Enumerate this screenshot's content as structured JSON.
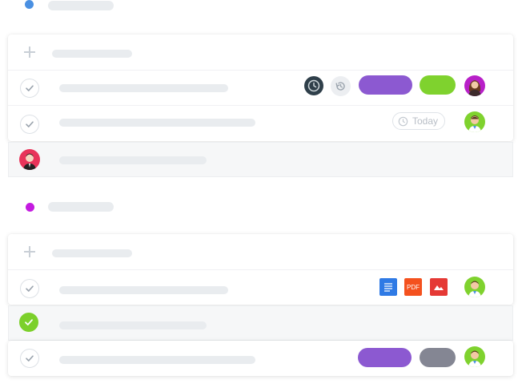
{
  "groups": [
    {
      "dot_color": "#4a90e2"
    },
    {
      "dot_color": "#c41be0"
    }
  ],
  "colors": {
    "pill_purple": "#8c59d1",
    "pill_green": "#7fd22e",
    "pill_gray": "#848693",
    "clock_dark": "#2f3f4a",
    "check_done": "#7cd02b",
    "doc_blue": "#2f7ae5",
    "pdf_orange": "#f4511e",
    "image_red": "#e53935"
  },
  "task_1_2": {
    "due_label": "Today"
  },
  "file_icons": {
    "pdf_label": "PDF"
  }
}
